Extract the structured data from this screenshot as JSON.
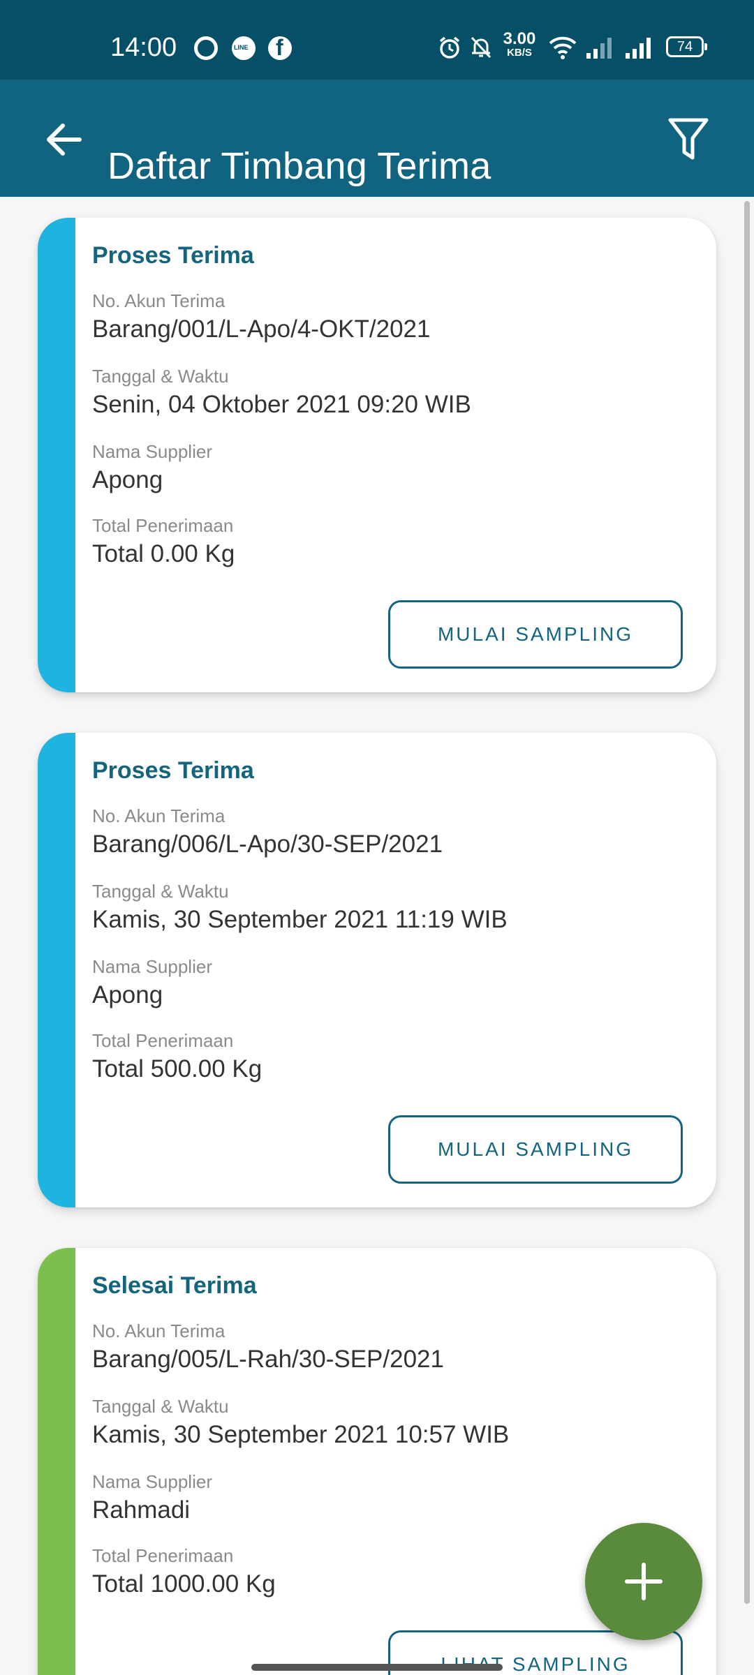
{
  "status_bar": {
    "time": "14:00",
    "notification_icons": [
      "whatsapp-icon",
      "line-icon",
      "facebook-icon"
    ],
    "network_speed_value": "3.00",
    "network_speed_unit": "KB/S",
    "battery": "74"
  },
  "app_bar": {
    "title": "Daftar Timbang Terima",
    "back_icon": "arrow-left-icon",
    "filter_icon": "filter-icon"
  },
  "cards": [
    {
      "status": "Proses Terima",
      "stripe_color": "#1fb3e0",
      "account_label": "No. Akun Terima",
      "account": "Barang/001/L-Apo/4-OKT/2021",
      "datetime_label": "Tanggal & Waktu",
      "datetime": "Senin, 04 Oktober 2021 09:20 WIB",
      "supplier_label": "Nama Supplier",
      "supplier": "Apong",
      "total_label": "Total Penerimaan",
      "total": "Total 0.00 Kg",
      "button": "MULAI SAMPLING"
    },
    {
      "status": "Proses Terima",
      "stripe_color": "#1fb3e0",
      "account_label": "No. Akun Terima",
      "account": "Barang/006/L-Apo/30-SEP/2021",
      "datetime_label": "Tanggal & Waktu",
      "datetime": "Kamis, 30 September 2021 11:19 WIB",
      "supplier_label": "Nama Supplier",
      "supplier": "Apong",
      "total_label": "Total Penerimaan",
      "total": "Total 500.00 Kg",
      "button": "MULAI SAMPLING"
    },
    {
      "status": "Selesai Terima",
      "stripe_color": "#7dbf4e",
      "account_label": "No. Akun Terima",
      "account": "Barang/005/L-Rah/30-SEP/2021",
      "datetime_label": "Tanggal & Waktu",
      "datetime": "Kamis, 30 September 2021 10:57 WIB",
      "supplier_label": "Nama Supplier",
      "supplier": "Rahmadi",
      "total_label": "Total Penerimaan",
      "total": "Total 1000.00 Kg",
      "button": "LIHAT SAMPLING"
    }
  ],
  "fab": {
    "icon": "plus-icon",
    "color": "#5a8a3c"
  },
  "colors": {
    "status_bar": "#054f67",
    "app_bar": "#106480",
    "accent": "#14647d"
  }
}
